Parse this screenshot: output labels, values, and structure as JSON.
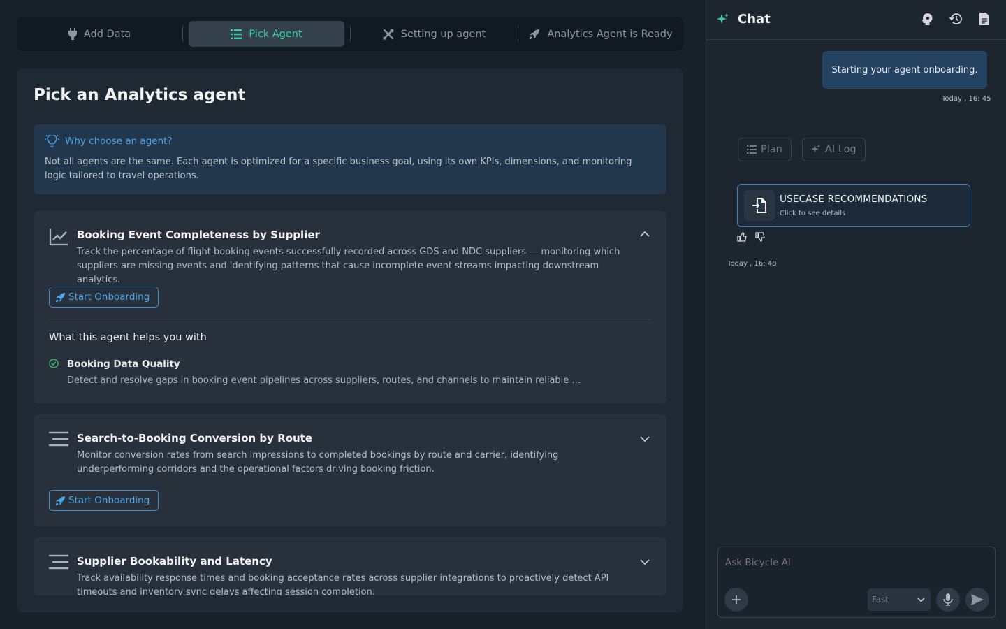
{
  "stepper": {
    "steps": [
      {
        "label": "Add Data",
        "icon": "plug-icon"
      },
      {
        "label": "Pick Agent",
        "icon": "list-icon"
      },
      {
        "label": "Setting up agent",
        "icon": "tools-icon"
      },
      {
        "label": "Analytics Agent is Ready",
        "icon": "rocket-icon"
      }
    ],
    "active_index": 1
  },
  "main": {
    "title": "Pick an Analytics agent",
    "info": {
      "heading": "Why choose an agent?",
      "body": "Not all agents are the same. Each agent is optimized for a specific business goal, using its own KPIs, dimensions, and monitoring logic tailored to travel operations."
    },
    "agents": [
      {
        "title": "Booking Event Completeness by Supplier",
        "description": "Track the percentage of flight booking events successfully recorded across GDS and NDC suppliers — monitoring which suppliers are missing events and identifying patterns that cause incomplete event streams impacting downstream analytics.",
        "button": "Start Onboarding",
        "expanded": true,
        "helps_title": "What this agent helps you with",
        "benefit_title": "Booking Data Quality",
        "benefit_desc": "Detect and resolve gaps in booking event pipelines across suppliers, routes, and channels to maintain reliable conve..."
      },
      {
        "title": "Search-to-Booking Conversion by Route",
        "description": "Monitor conversion rates from search impressions to completed bookings by route and carrier, identifying underperforming corridors and the operational factors driving booking friction.",
        "button": "Start Onboarding",
        "expanded": false
      },
      {
        "title": "Supplier Bookability and Latency",
        "description": "Track availability response times and booking acceptance rates across supplier integrations to proactively detect API timeouts and inventory sync delays affecting session completion.",
        "expanded": false
      }
    ]
  },
  "chat": {
    "title": "Chat",
    "header_icons": [
      "brain-icon",
      "history-icon",
      "document-icon"
    ],
    "user_message": "Starting your agent onboarding.",
    "user_timestamp": "Today , 16: 45",
    "tabs": [
      "Plan",
      "AI Log"
    ],
    "recommendation": {
      "title": "USECASE RECOMMENDATIONS",
      "subtitle": "Click to see details"
    },
    "reply_timestamp": "Today , 16: 48",
    "composer": {
      "placeholder": "Ask Bicycle AI",
      "mode": "Fast"
    }
  },
  "colors": {
    "accent_green": "#3ad0a0",
    "accent_blue": "#4aa6ea",
    "background": "#182029"
  }
}
